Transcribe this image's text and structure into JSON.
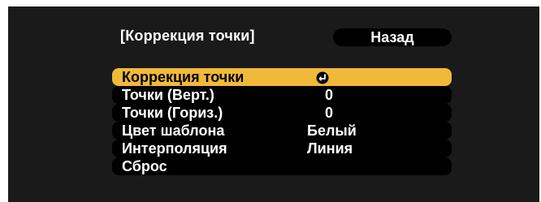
{
  "header": {
    "title": "[Коррекция точки]",
    "back_label": "Назад"
  },
  "menu": {
    "items": [
      {
        "label": "Коррекция точки",
        "value": "",
        "icon": "enter-icon",
        "selected": true
      },
      {
        "label": "Точки (Верт.)",
        "value": "0"
      },
      {
        "label": "Точки (Гориз.)",
        "value": "0"
      },
      {
        "label": "Цвет шаблона",
        "value": "Белый"
      },
      {
        "label": "Интерполяция",
        "value": "Линия"
      },
      {
        "label": "Сброс",
        "value": ""
      }
    ]
  },
  "colors": {
    "background": "#1a1a1a",
    "highlight": "#f0b93a",
    "row": "#000000",
    "text": "#ffffff"
  }
}
